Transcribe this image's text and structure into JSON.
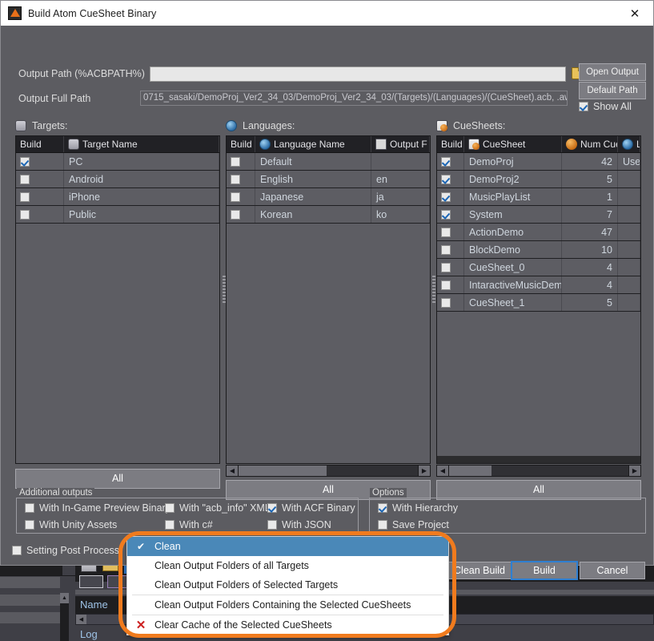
{
  "window": {
    "title": "Build Atom CueSheet Binary",
    "app_icon": "cri-atom-icon",
    "close_label": "✕"
  },
  "paths": {
    "output_path_label": "Output Path (%ACBPATH%)",
    "output_path_value": "",
    "output_path_placeholder": "",
    "browse_icon": "open-folder-icon",
    "full_path_label": "Output Full Path",
    "full_path_value": "0715_sasaki/DemoProj_Ver2_34_03/DemoProj_Ver2_34_03/(Targets)/(Languages)/(CueSheet).acb, .awb",
    "open_output_button": "Open Output",
    "default_path_button": "Default Path",
    "show_all_label": "Show All",
    "show_all_checked": true
  },
  "targets": {
    "panel_title": "Targets:",
    "panel_icon": "monitor-icon",
    "columns": [
      "Build",
      "Target Name"
    ],
    "column_icon": "monitor-icon",
    "rows": [
      {
        "build": true,
        "name": "PC"
      },
      {
        "build": false,
        "name": "Android"
      },
      {
        "build": false,
        "name": "iPhone"
      },
      {
        "build": false,
        "name": "Public"
      }
    ],
    "all_button": "All"
  },
  "languages": {
    "panel_title": "Languages:",
    "panel_icon": "globe-icon",
    "columns": [
      "Build",
      "Language Name",
      "Output F"
    ],
    "column_icon": "globe-icon",
    "folder_icon": "folder-icon",
    "rows": [
      {
        "build": false,
        "name": "Default",
        "output": ""
      },
      {
        "build": false,
        "name": "English",
        "output": "en"
      },
      {
        "build": false,
        "name": "Japanese",
        "output": "ja"
      },
      {
        "build": false,
        "name": "Korean",
        "output": "ko"
      }
    ],
    "all_button": "All"
  },
  "cuesheets": {
    "panel_title": "CueSheets:",
    "panel_icon": "cuesheet-icon",
    "columns": [
      "Build",
      "CueSheet",
      "Num Cues",
      "La"
    ],
    "column_icon_cuesheet": "cuesheet-icon",
    "column_icon_numcues": "orange-ball-icon",
    "column_icon_language": "globe-icon",
    "rows": [
      {
        "build": true,
        "name": "DemoProj",
        "num_cues": "42",
        "lang": "Use"
      },
      {
        "build": true,
        "name": "DemoProj2",
        "num_cues": "5",
        "lang": ""
      },
      {
        "build": true,
        "name": "MusicPlayList",
        "num_cues": "1",
        "lang": ""
      },
      {
        "build": true,
        "name": "System",
        "num_cues": "7",
        "lang": ""
      },
      {
        "build": false,
        "name": "ActionDemo",
        "num_cues": "47",
        "lang": ""
      },
      {
        "build": false,
        "name": "BlockDemo",
        "num_cues": "10",
        "lang": ""
      },
      {
        "build": false,
        "name": "CueSheet_0",
        "num_cues": "4",
        "lang": ""
      },
      {
        "build": false,
        "name": "IntaractiveMusicDemo",
        "num_cues": "4",
        "lang": ""
      },
      {
        "build": false,
        "name": "CueSheet_1",
        "num_cues": "5",
        "lang": ""
      }
    ],
    "all_button": "All"
  },
  "additional_outputs": {
    "group_title": "Additional outputs",
    "items": [
      {
        "label": "With In-Game Preview Binary",
        "checked": false
      },
      {
        "label": "With \"acb_info\" XML",
        "checked": false
      },
      {
        "label": "With ACF Binary",
        "checked": true
      },
      {
        "label": "With Unity Assets",
        "checked": false
      },
      {
        "label": "With c#",
        "checked": false
      },
      {
        "label": "With JSON",
        "checked": false
      }
    ]
  },
  "options": {
    "group_title": "Options",
    "items": [
      {
        "label": "With Hierarchy",
        "checked": true
      },
      {
        "label": "Save Project",
        "checked": false
      }
    ]
  },
  "post_process": {
    "label": "Setting Post Process",
    "checked": false
  },
  "footer_buttons": {
    "clean_build": "Clean Build",
    "build": "Build",
    "cancel": "Cancel"
  },
  "context_menu": {
    "highlight_color": "#f07b1e",
    "selected_color": "#4a88b8",
    "items": [
      {
        "label": "Clean",
        "icon": "check-icon",
        "selected": true,
        "separator_after": false
      },
      {
        "label": "Clean Output Folders of all Targets",
        "icon": "",
        "selected": false,
        "separator_after": false
      },
      {
        "label": "Clean Output Folders of Selected Targets",
        "icon": "",
        "selected": false,
        "separator_after": true
      },
      {
        "label": "Clean Output Folders Containing the Selected CueSheets",
        "icon": "",
        "selected": false,
        "separator_after": true
      },
      {
        "label": "Clear Cache of the Selected CueSheets",
        "icon": "x-mark-icon",
        "selected": false,
        "separator_after": false
      }
    ]
  },
  "background_app": {
    "name_column_header": "Name",
    "log_label": "Log"
  }
}
